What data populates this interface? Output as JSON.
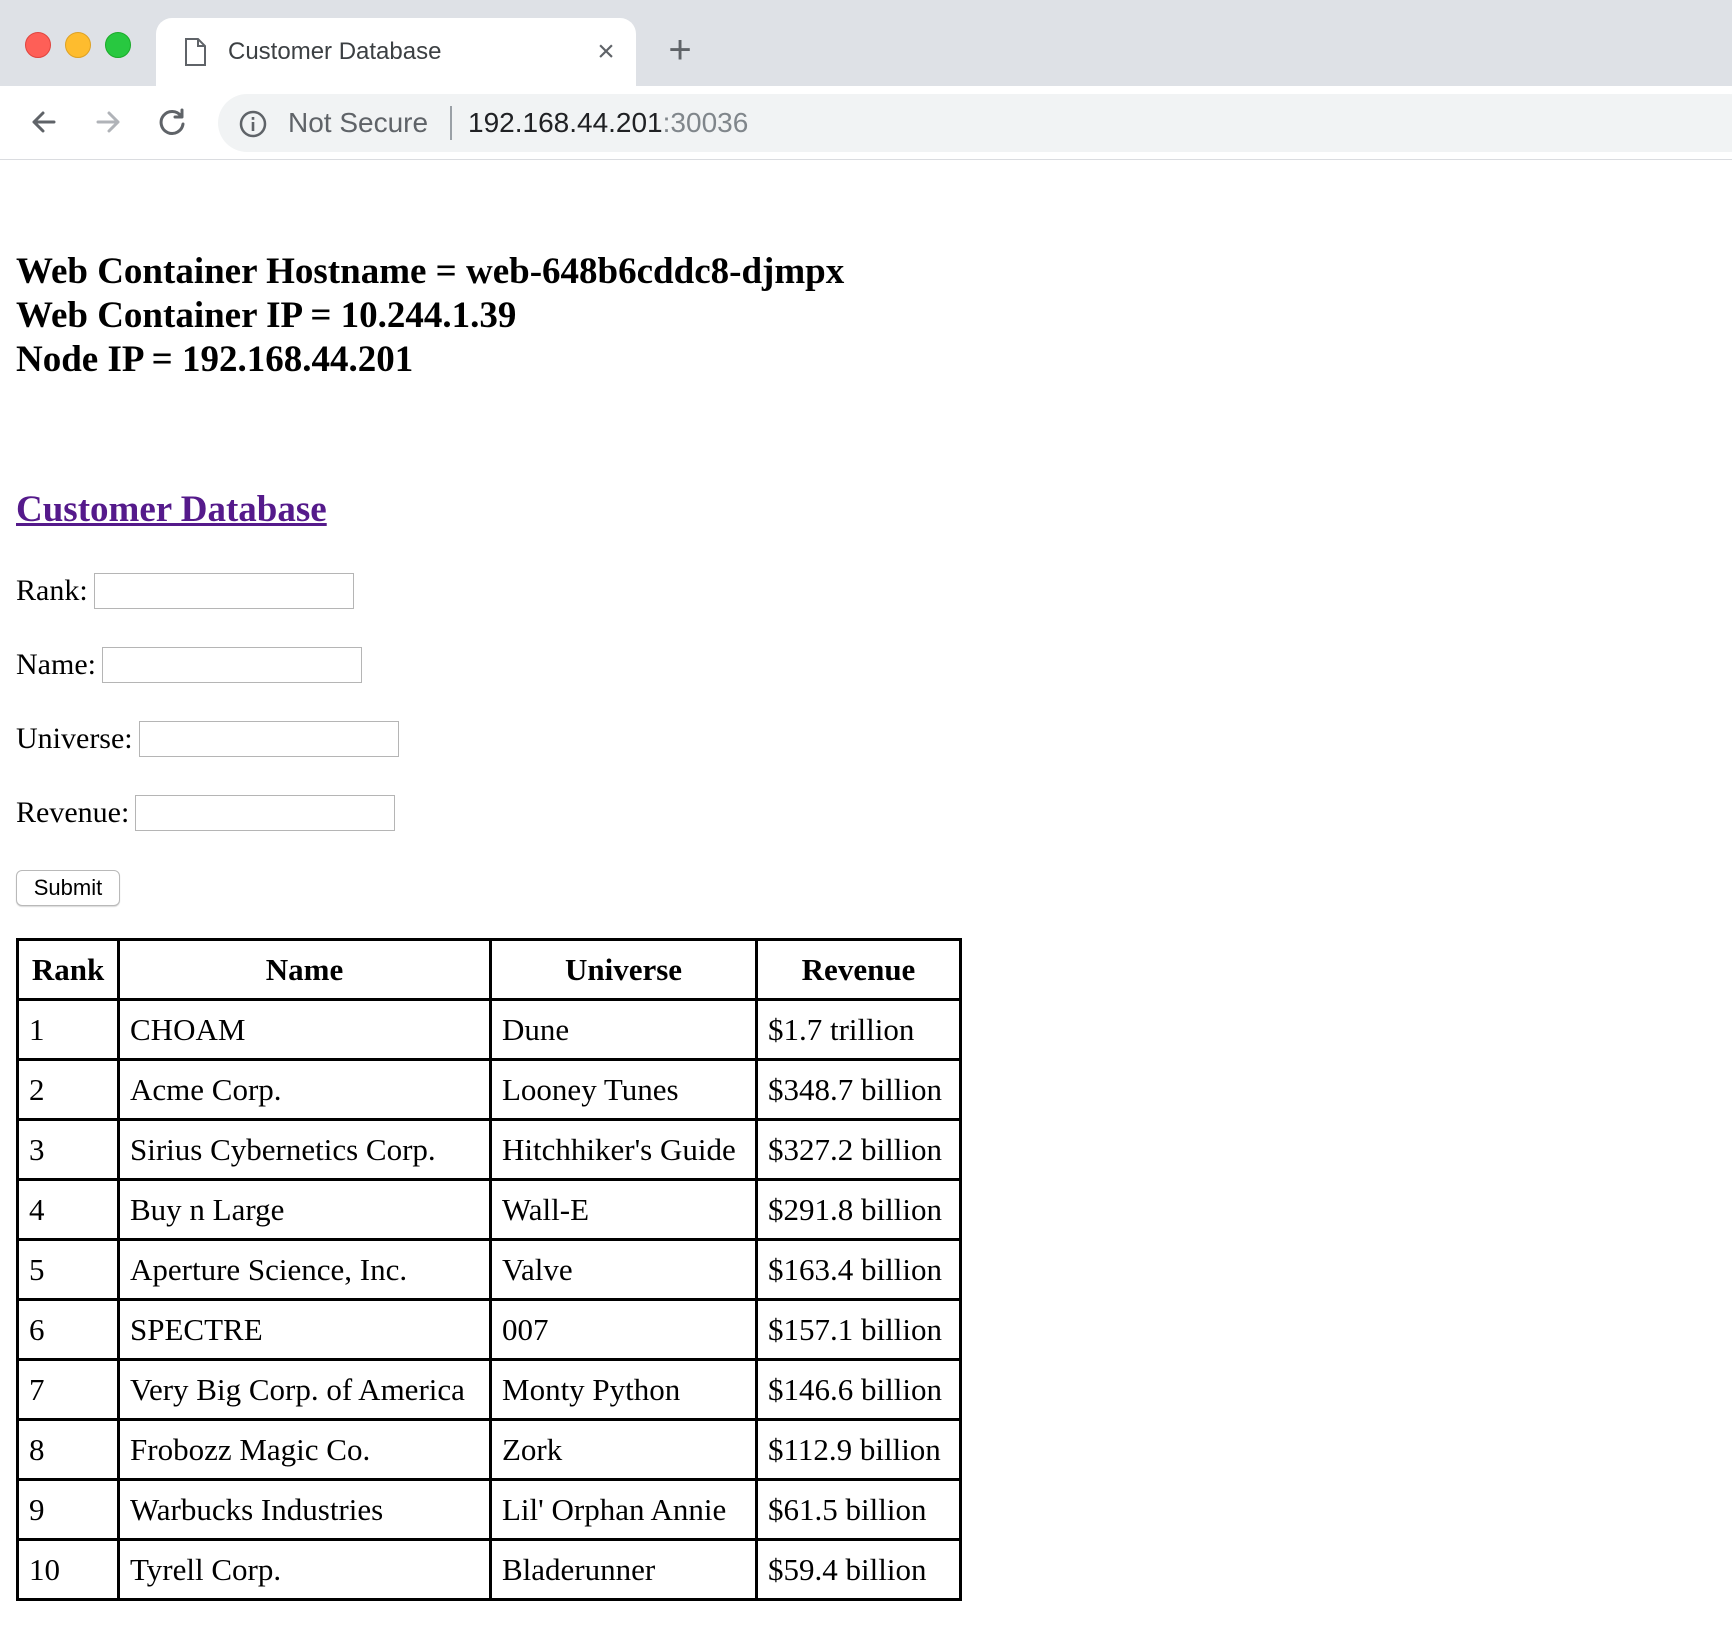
{
  "browser": {
    "tab_title": "Customer Database",
    "url_security": "Not Secure",
    "url_host": "192.168.44.201",
    "url_port": ":30036",
    "new_tab_label": "+",
    "close_label": "×"
  },
  "host_info": {
    "hostname_line": "Web Container Hostname = web-648b6cddc8-djmpx",
    "ip_line": "Web Container IP = 10.244.1.39",
    "node_line": "Node IP = 192.168.44.201"
  },
  "page": {
    "db_link": "Customer Database"
  },
  "form": {
    "rank_label": "Rank:",
    "name_label": "Name:",
    "universe_label": "Universe:",
    "revenue_label": "Revenue:",
    "rank_value": "",
    "name_value": "",
    "universe_value": "",
    "revenue_value": "",
    "submit_label": "Submit"
  },
  "table": {
    "headers": [
      "Rank",
      "Name",
      "Universe",
      "Revenue"
    ],
    "rows": [
      [
        "1",
        "CHOAM",
        "Dune",
        "$1.7 trillion"
      ],
      [
        "2",
        "Acme Corp.",
        "Looney Tunes",
        "$348.7 billion"
      ],
      [
        "3",
        "Sirius Cybernetics Corp.",
        "Hitchhiker's Guide",
        "$327.2 billion"
      ],
      [
        "4",
        "Buy n Large",
        "Wall-E",
        "$291.8 billion"
      ],
      [
        "5",
        "Aperture Science, Inc.",
        "Valve",
        "$163.4 billion"
      ],
      [
        "6",
        "SPECTRE",
        "007",
        "$157.1 billion"
      ],
      [
        "7",
        "Very Big Corp. of America",
        "Monty Python",
        "$146.6 billion"
      ],
      [
        "8",
        "Frobozz Magic Co.",
        "Zork",
        "$112.9 billion"
      ],
      [
        "9",
        "Warbucks Industries",
        "Lil' Orphan Annie",
        "$61.5 billion"
      ],
      [
        "10",
        "Tyrell Corp.",
        "Bladerunner",
        "$59.4 billion"
      ]
    ]
  }
}
